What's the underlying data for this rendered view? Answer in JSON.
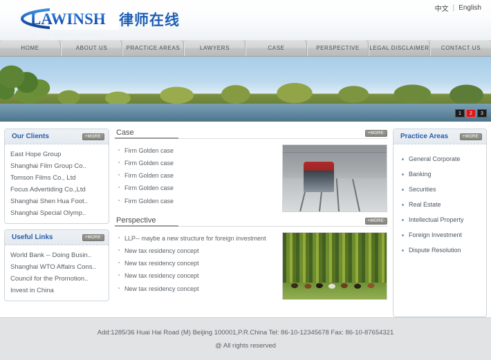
{
  "header": {
    "logo_text": "LAWINSH",
    "site_subtitle": "律师在线",
    "lang_cn": "中文",
    "lang_sep": "|",
    "lang_en": "English"
  },
  "nav": {
    "items": [
      {
        "label": "HOME"
      },
      {
        "label": "ABOUT US"
      },
      {
        "label": "PRACTICE AREAS"
      },
      {
        "label": "LAWYERS"
      },
      {
        "label": "CASE"
      },
      {
        "label": "PERSPECTIVE"
      },
      {
        "label": "LEGAL DISCLAIMER"
      },
      {
        "label": "CONTACT US"
      }
    ]
  },
  "banner": {
    "alt": "river-landscape-banner",
    "pager": [
      {
        "label": "1",
        "active": false
      },
      {
        "label": "2",
        "active": true
      },
      {
        "label": "3",
        "active": false
      }
    ]
  },
  "sidebar_left": {
    "clients": {
      "title": "Our Clients",
      "more_label": "+MORE",
      "items": [
        {
          "label": "East Hope Group"
        },
        {
          "label": "Shanghai Film Group Co.."
        },
        {
          "label": "Tomson Films Co., Ltd"
        },
        {
          "label": "Focus Advertiding Co.,Ltd"
        },
        {
          "label": "Shanghai Shen Hua Foot.."
        },
        {
          "label": "Shanghai Special Olymp.."
        }
      ]
    },
    "links": {
      "title": "Useful Links",
      "more_label": "+MORE",
      "items": [
        {
          "label": "World Bank -- Doing Busin.."
        },
        {
          "label": "Shanghai WTO Affairs Cons.."
        },
        {
          "label": "Council for the Promotion.."
        },
        {
          "label": "Invest in China"
        }
      ]
    }
  },
  "main": {
    "case": {
      "title": "Case",
      "more_label": "+MORE",
      "image_alt": "train-on-snowy-tracks",
      "items": [
        {
          "label": "Firm Golden case"
        },
        {
          "label": "Firm Golden case"
        },
        {
          "label": "Firm Golden case"
        },
        {
          "label": "Firm Golden case"
        },
        {
          "label": "Firm Golden case"
        }
      ]
    },
    "perspective": {
      "title": "Perspective",
      "more_label": "+MORE",
      "image_alt": "cattle-herd-in-pasture",
      "items": [
        {
          "label": "LLP-- maybe a new structure for foreign investment"
        },
        {
          "label": "New tax residency concept"
        },
        {
          "label": "New tax residency concept"
        },
        {
          "label": "New tax residency concept"
        },
        {
          "label": "New tax residency concept"
        }
      ]
    }
  },
  "sidebar_right": {
    "title": "Practice Areas",
    "more_label": "+MORE",
    "items": [
      {
        "label": "General Corporate"
      },
      {
        "label": "Banking"
      },
      {
        "label": "Securities"
      },
      {
        "label": "Real Estate"
      },
      {
        "label": "Intellectual Property"
      },
      {
        "label": "Foreign Investment"
      },
      {
        "label": "Dispute Resolution"
      }
    ]
  },
  "footer": {
    "address_line": "Add:1285/36 Huai Hai Road (M) Beijing 100001,P.R.China Tel: 86-10-12345678 Fax: 86-10-87654321",
    "copyright_line": "@ All rights reserved"
  },
  "colors": {
    "brand_blue": "#1e5fb4",
    "panel_title_blue": "#2a5ca8",
    "pager_active_red": "#d81a1a",
    "nav_gray": "#c4c6c6",
    "footer_gray": "#e2e3e4"
  }
}
